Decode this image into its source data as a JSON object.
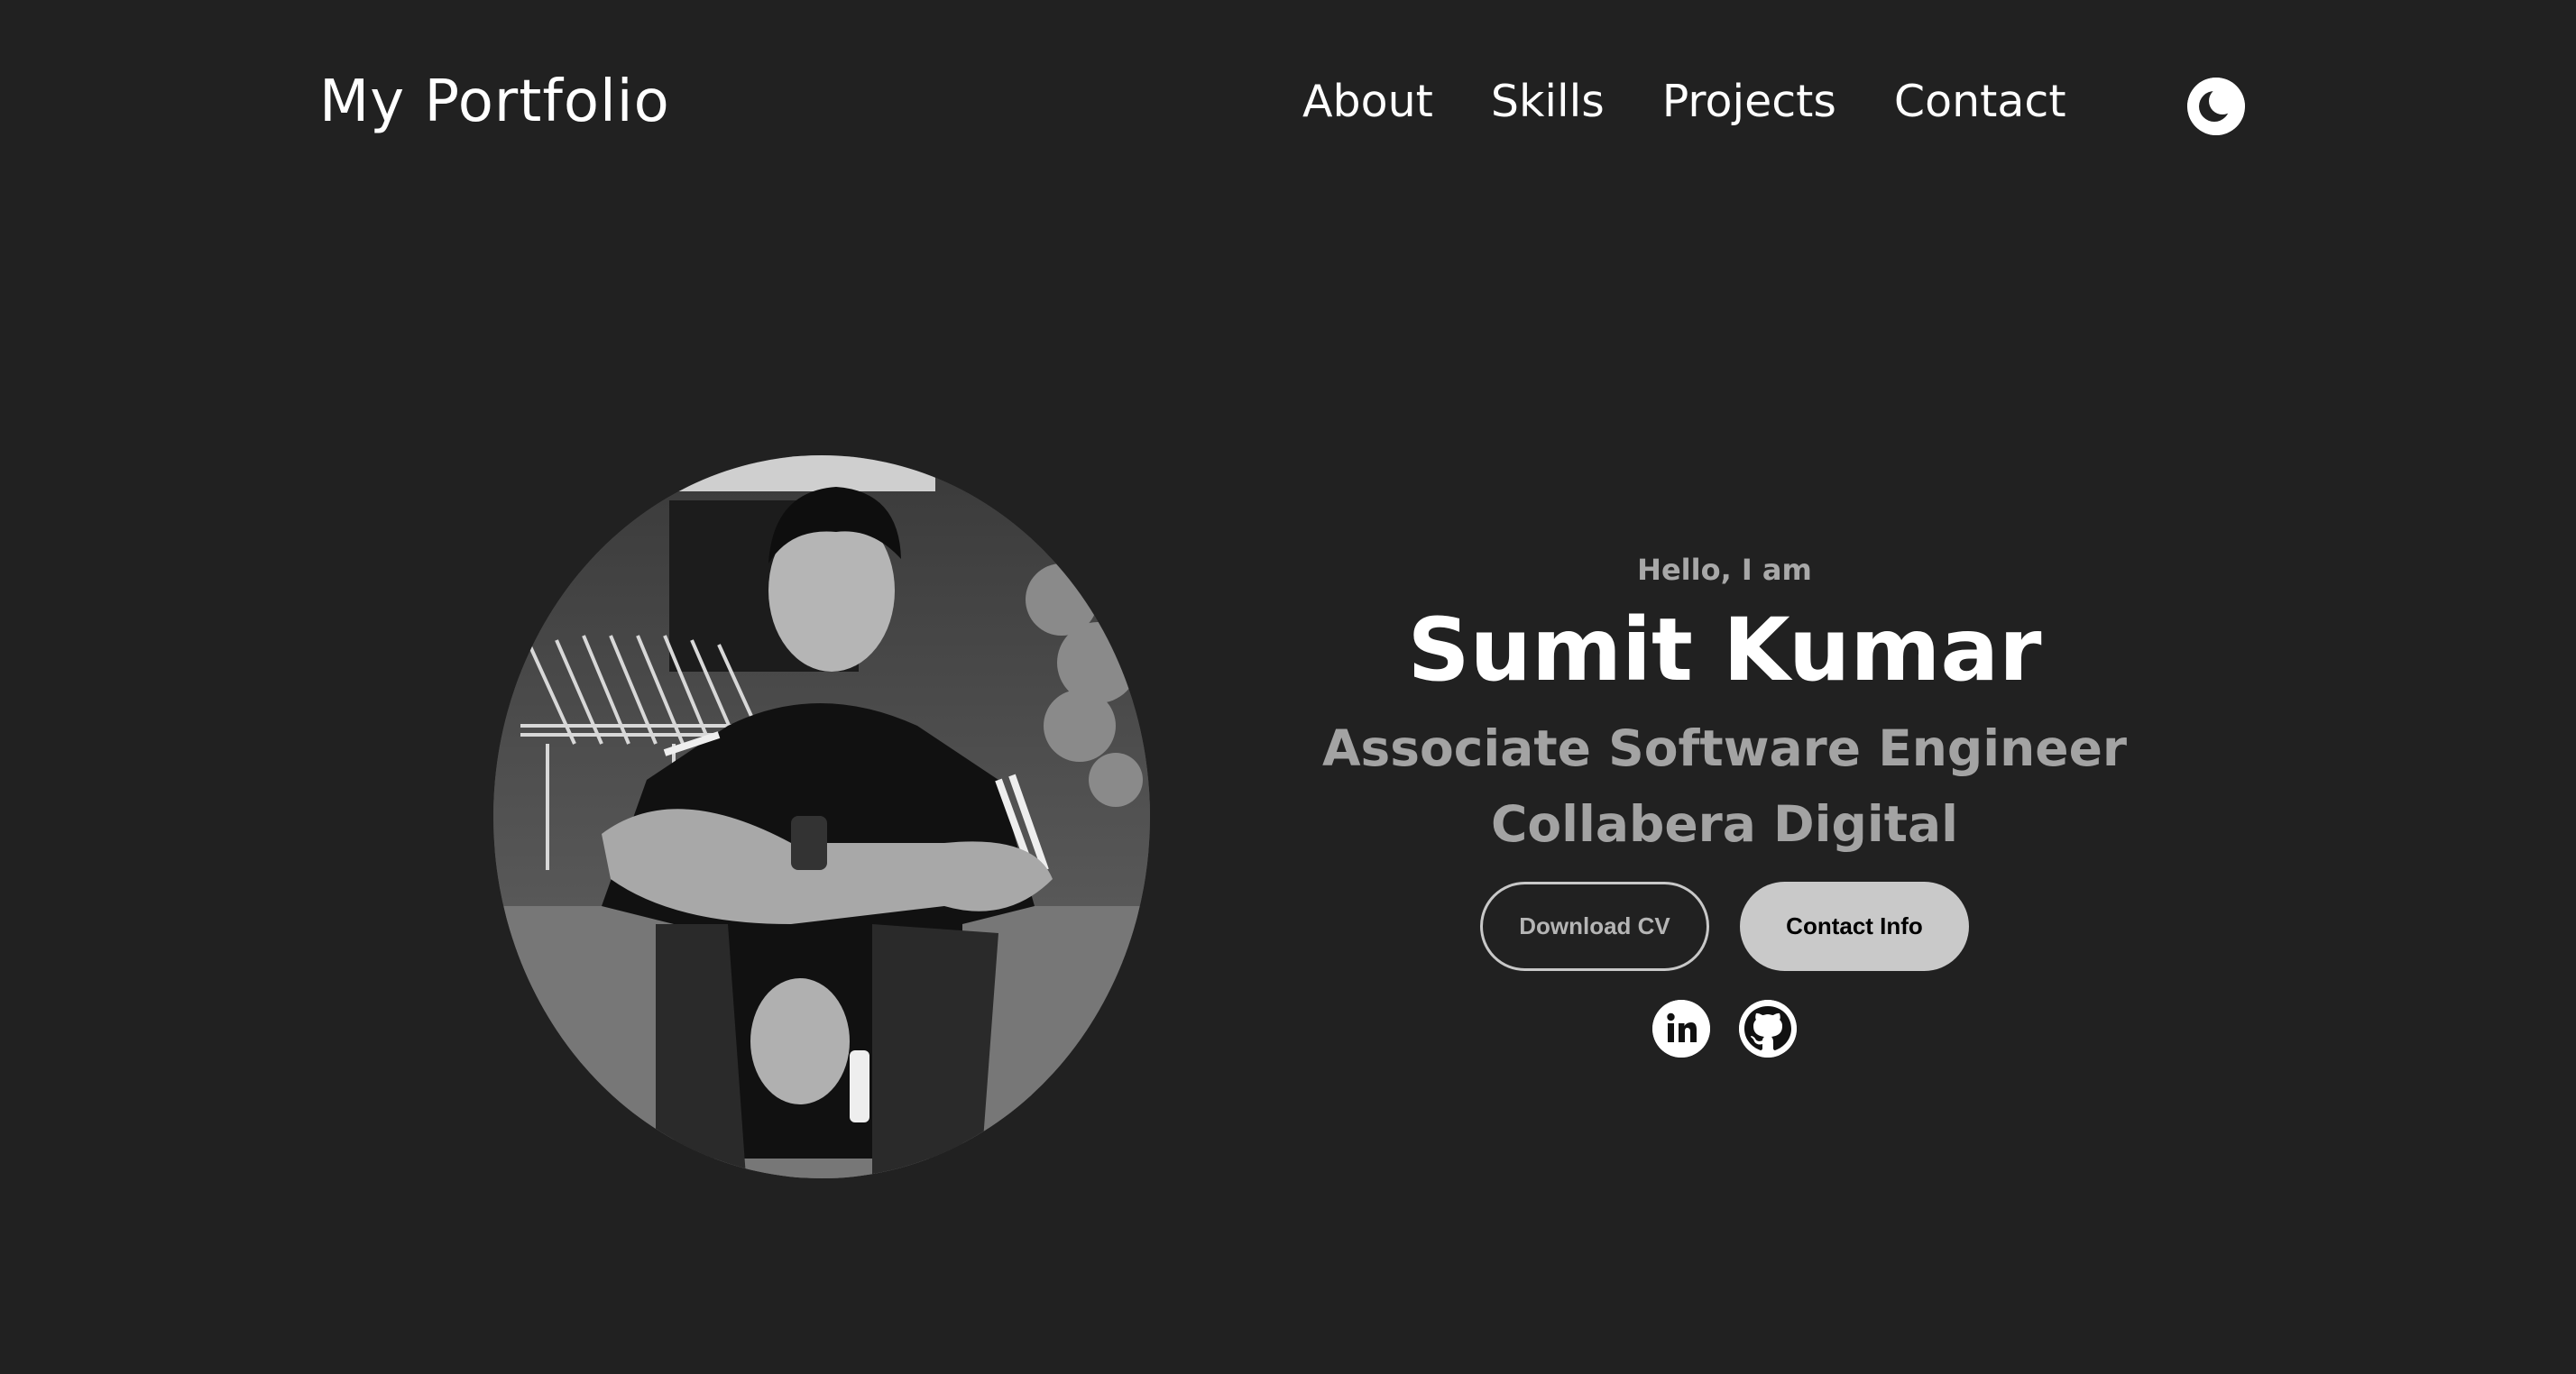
{
  "header": {
    "logo": "My Portfolio",
    "nav": [
      "About",
      "Skills",
      "Projects",
      "Contact"
    ],
    "theme_icon": "moon-icon"
  },
  "profile": {
    "photo_icon": "profile-photo"
  },
  "hero": {
    "greeting": "Hello, I am",
    "name": "Sumit Kumar",
    "role": "Associate Software Engineer",
    "company": "Collabera Digital",
    "buttons": {
      "download_cv": "Download CV",
      "contact_info": "Contact Info"
    },
    "socials": [
      {
        "icon": "linkedin-icon"
      },
      {
        "icon": "github-icon"
      }
    ]
  },
  "colors": {
    "background": "#212121",
    "text_primary": "#ffffff",
    "text_muted": "#a3a3a3",
    "button_solid": "#c9c9c9"
  }
}
